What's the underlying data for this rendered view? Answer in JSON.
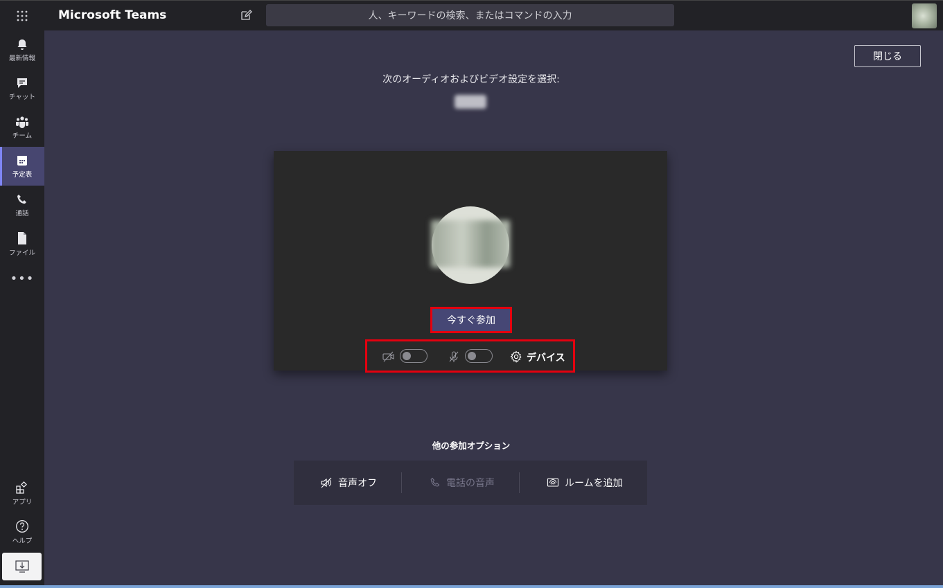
{
  "app": {
    "title": "Microsoft Teams"
  },
  "search": {
    "placeholder": "人、キーワードの検索、またはコマンドの入力"
  },
  "rail": {
    "items": [
      {
        "label": "最新情報",
        "icon": "bell-icon"
      },
      {
        "label": "チャット",
        "icon": "chat-icon"
      },
      {
        "label": "チーム",
        "icon": "teams-icon"
      },
      {
        "label": "予定表",
        "icon": "calendar-icon",
        "active": true
      },
      {
        "label": "通話",
        "icon": "phone-icon"
      },
      {
        "label": "ファイル",
        "icon": "file-icon"
      }
    ],
    "more": "•••",
    "bottom": [
      {
        "label": "アプリ",
        "icon": "apps-icon"
      },
      {
        "label": "ヘルプ",
        "icon": "help-icon"
      }
    ]
  },
  "header": {
    "close_label": "閉じる"
  },
  "prejoin": {
    "choose_label": "次のオーディオおよびビデオ設定を選択:",
    "join_label": "今すぐ参加",
    "camera_on": false,
    "mic_on": false,
    "devices_label": "デバイス"
  },
  "other_options": {
    "title": "他の参加オプション",
    "items": [
      {
        "label": "音声オフ",
        "icon": "speaker-off-icon",
        "enabled": true
      },
      {
        "label": "電話の音声",
        "icon": "phone-icon",
        "enabled": false
      },
      {
        "label": "ルームを追加",
        "icon": "cast-room-icon",
        "enabled": true
      }
    ]
  },
  "colors": {
    "accent": "#464775",
    "highlight": "#e4000f",
    "background": "#37364a",
    "rail": "#222226"
  }
}
